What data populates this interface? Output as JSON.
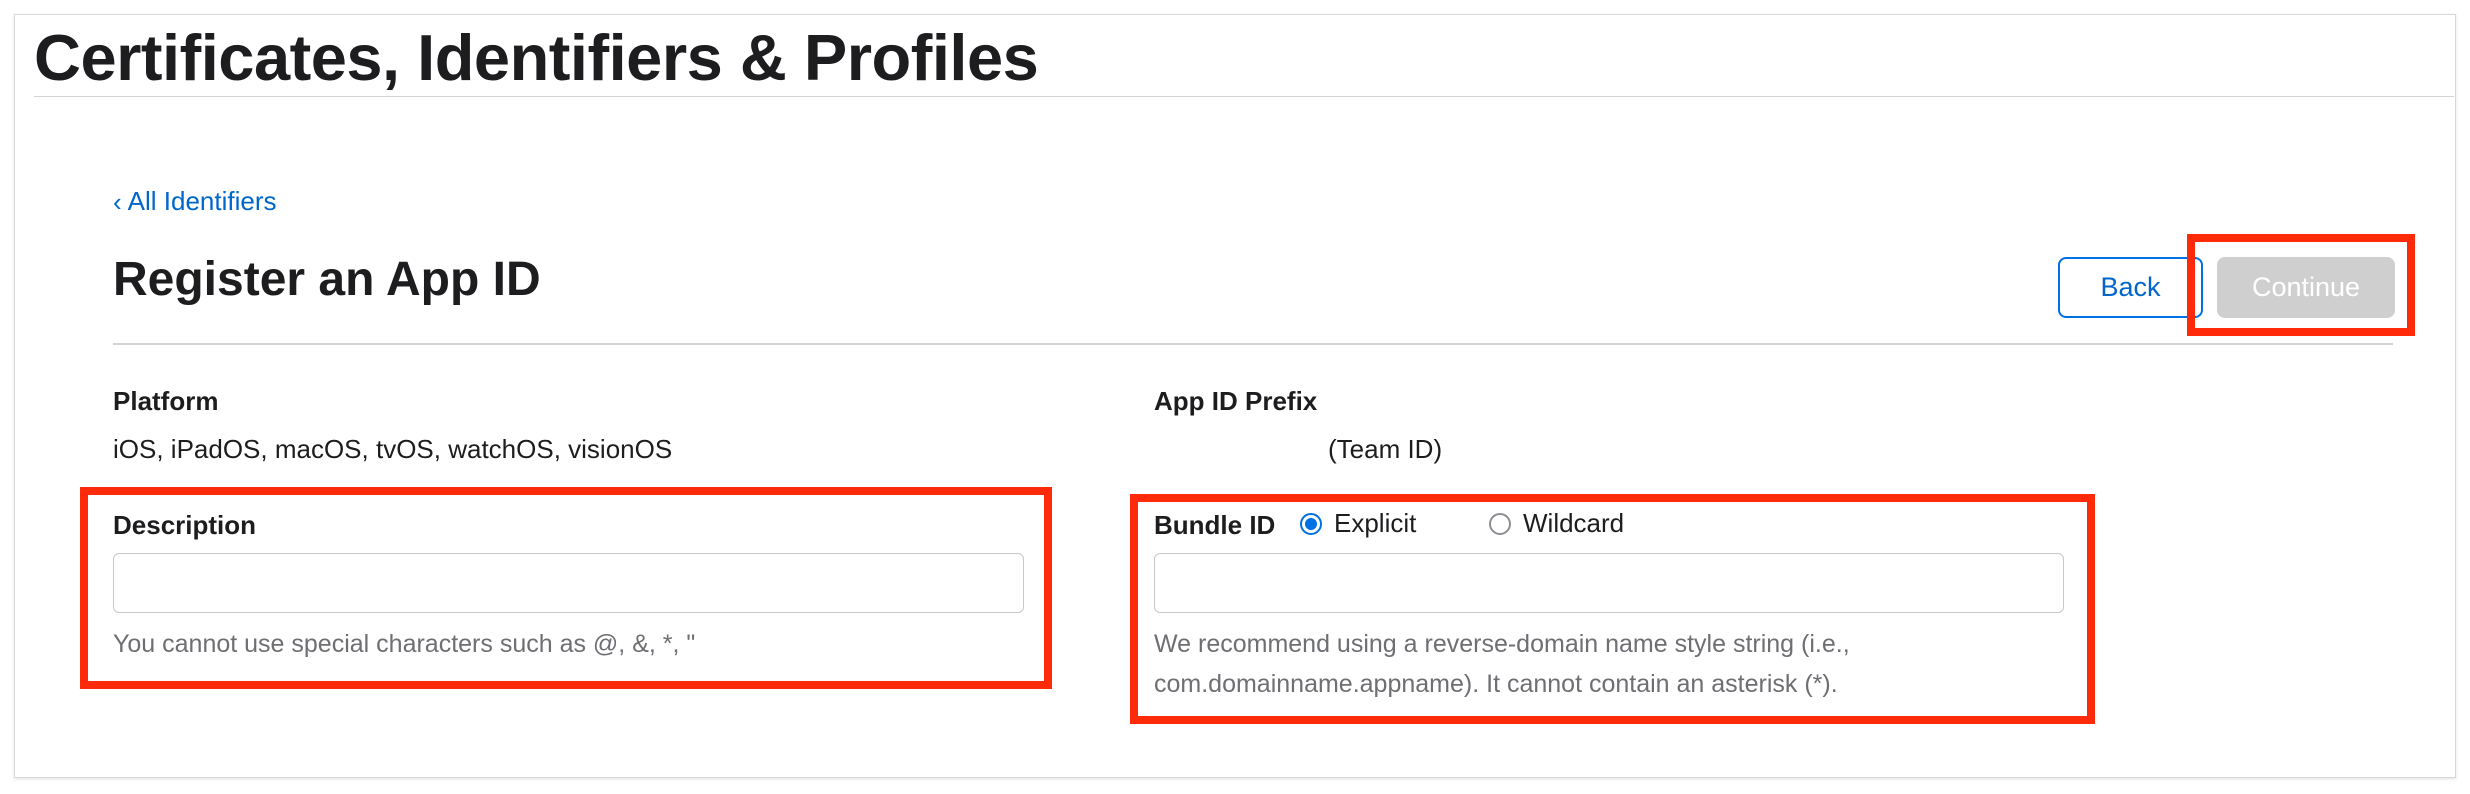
{
  "header": {
    "title": "Certificates, Identifiers & Profiles"
  },
  "breadcrumb": {
    "chevron": "‹",
    "label": "All Identifiers"
  },
  "section": {
    "title": "Register an App ID"
  },
  "actions": {
    "back_label": "Back",
    "continue_label": "Continue"
  },
  "platform": {
    "label": "Platform",
    "value": "iOS, iPadOS, macOS, tvOS, watchOS, visionOS"
  },
  "prefix": {
    "label": "App ID Prefix",
    "value": "(Team ID)"
  },
  "description": {
    "label": "Description",
    "value": "",
    "help": "You cannot use special characters such as @, &, *, \""
  },
  "bundle_id": {
    "label": "Bundle ID",
    "options": [
      {
        "label": "Explicit",
        "selected": true
      },
      {
        "label": "Wildcard",
        "selected": false
      }
    ],
    "value": "",
    "help_line1": "We recommend using a reverse-domain name style string (i.e.,",
    "help_line2": "com.domainname.appname). It cannot contain an asterisk (*)."
  },
  "colors": {
    "accent": "#0071e3",
    "link": "#0066cc",
    "highlight": "#ff2a0a",
    "disabled_button": "#cfcfcf"
  }
}
